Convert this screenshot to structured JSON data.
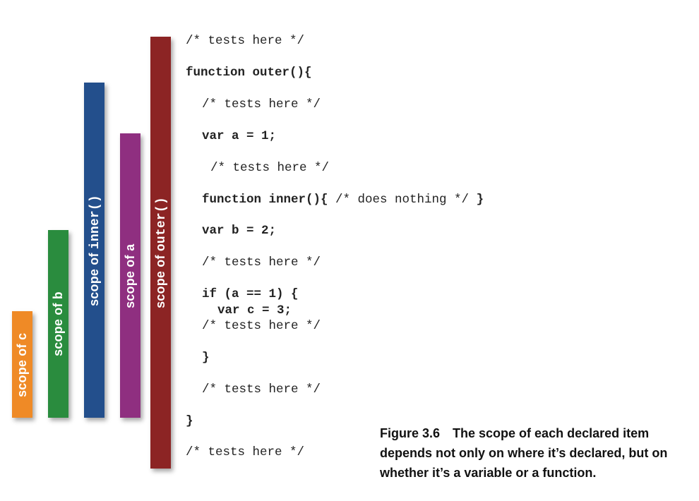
{
  "colors": {
    "scope_c": "#ef8a26",
    "scope_b": "#2a8c3e",
    "scope_inner": "#234f8c",
    "scope_a": "#8f2f80",
    "scope_outer": "#8c2424"
  },
  "bars": {
    "c": {
      "prefix": "scope of ",
      "name": "c"
    },
    "b": {
      "prefix": "scope of ",
      "name": "b"
    },
    "inner": {
      "prefix": "scope of ",
      "name": "inner()"
    },
    "a": {
      "prefix": "scope of ",
      "name": "a"
    },
    "outer": {
      "prefix": "scope of ",
      "name": "outer()"
    }
  },
  "code": {
    "l1": "/* tests here */",
    "l2": "function outer(){",
    "l3": "/* tests here */",
    "l4": "var a = 1;",
    "l5": "/* tests here */",
    "l6_kw": "function inner(){",
    "l6_comment": " /* does nothing */ ",
    "l6_end": "}",
    "l7": "var b = 2;",
    "l8": "/* tests here */",
    "l9": "if (a == 1) {",
    "l10": "var c = 3;",
    "l11": "/* tests here */",
    "l12": "}",
    "l13": "/* tests here */",
    "l14": "}",
    "l15": "/* tests here */"
  },
  "caption": {
    "number": "Figure 3.6",
    "text": "The scope of each declared item depends not only on where it’s declared, but on whether it’s a variable or a function."
  }
}
